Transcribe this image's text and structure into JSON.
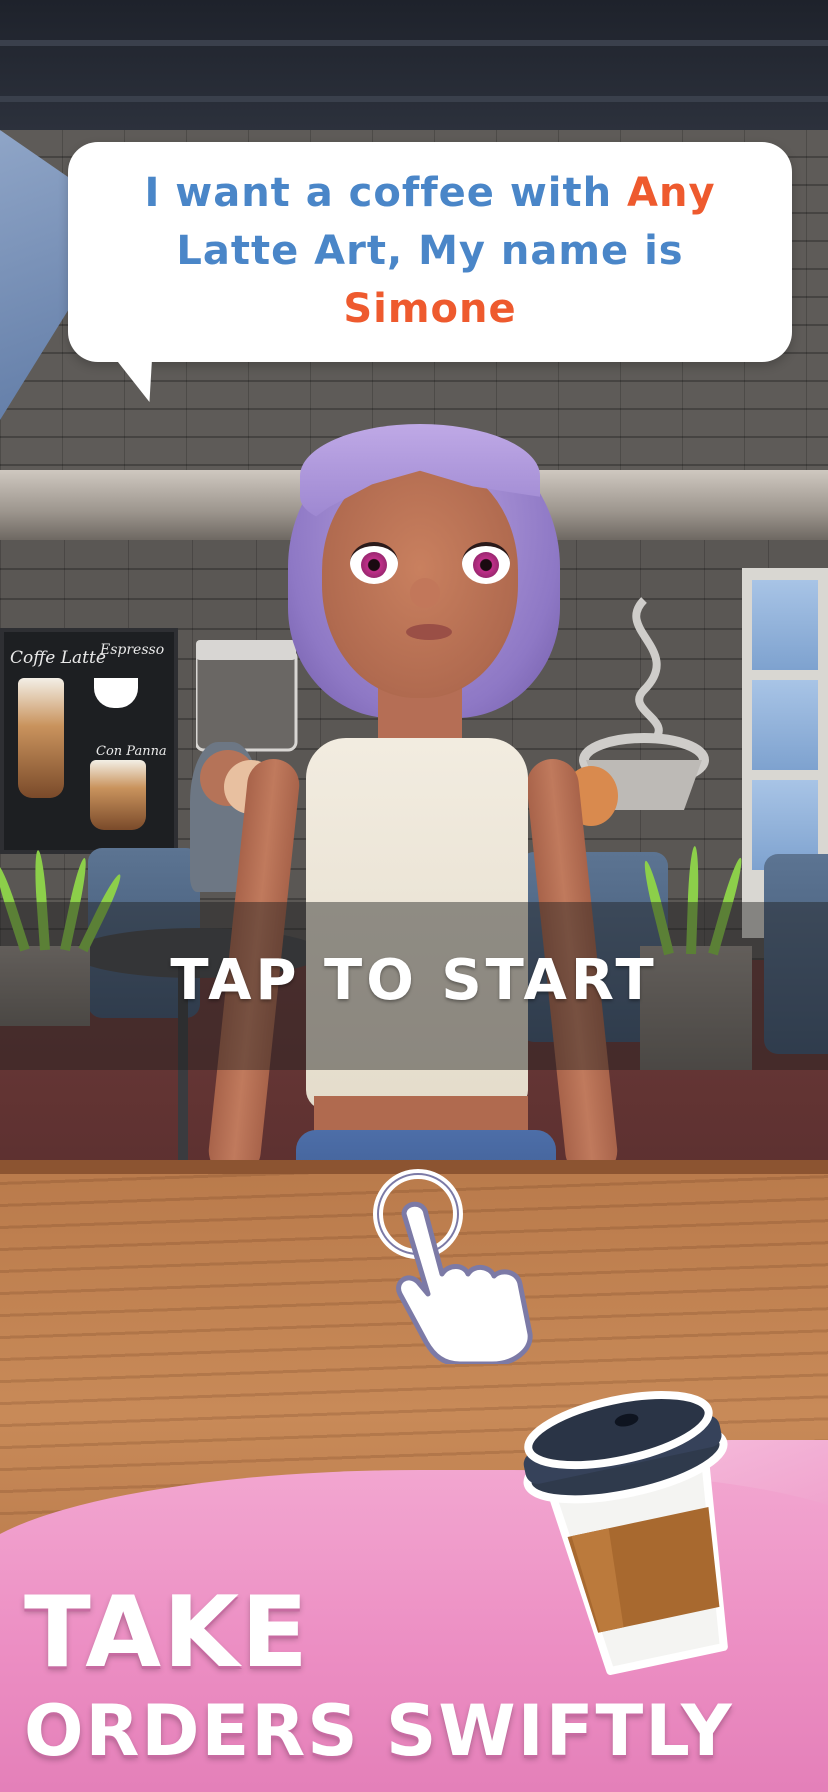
{
  "speech_bubble": {
    "part1": "I want a coffee with ",
    "highlight1": "Any",
    "part2": " Latte Art, My name is ",
    "highlight2": "Simone"
  },
  "chalkboard": {
    "label_left": "Coffe Latte",
    "label_right": "Espresso",
    "label_bottom": "Con Panna"
  },
  "tap_prompt": "TAP TO START",
  "headline": {
    "line1": "TAKE",
    "line2": "ORDERS SWIFTLY"
  },
  "colors": {
    "bubble_text": "#4a86c8",
    "bubble_highlight": "#ee5a2e",
    "pink_banner": "#ec8ec3",
    "headline_shadow": "#c76ba1"
  },
  "icons": {
    "hand": "tap-hand-icon",
    "cup": "coffee-cup-icon"
  }
}
